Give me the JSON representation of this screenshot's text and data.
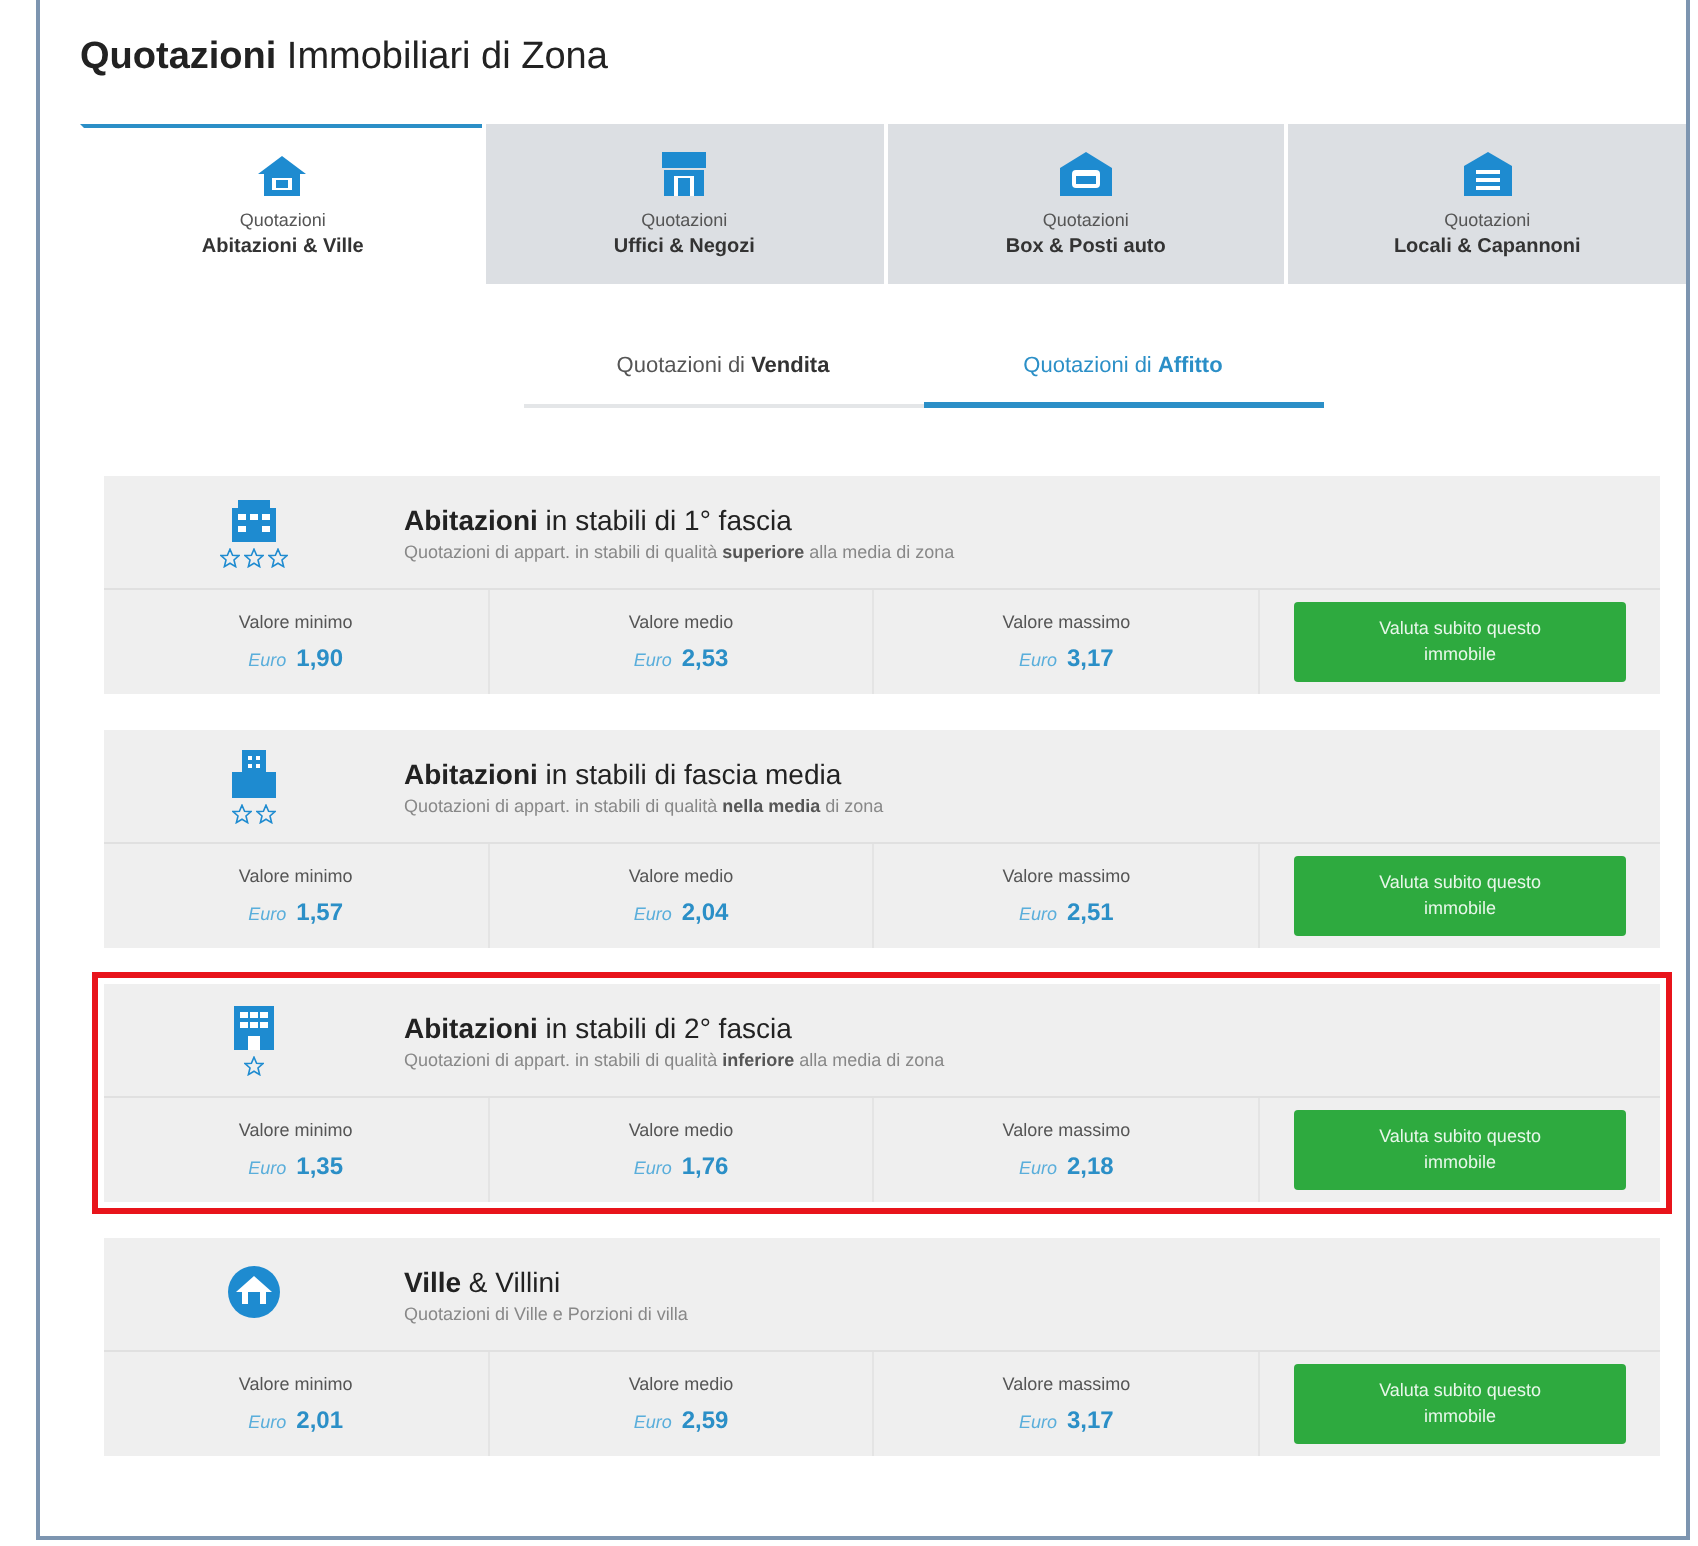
{
  "title": {
    "bold": "Quotazioni",
    "rest": "Immobiliari di Zona"
  },
  "tabs": [
    {
      "label_top": "Quotazioni",
      "label": "Abitazioni & Ville",
      "selected": true
    },
    {
      "label_top": "Quotazioni",
      "label": "Uffici & Negozi",
      "selected": false
    },
    {
      "label_top": "Quotazioni",
      "label": "Box & Posti auto",
      "selected": false
    },
    {
      "label_top": "Quotazioni",
      "label": "Locali & Capannoni",
      "selected": false
    }
  ],
  "subtabs": [
    {
      "label": "Quotazioni di **Vendita**",
      "selected": false
    },
    {
      "label": "Quotazioni di **Affitto**",
      "selected": true
    }
  ],
  "cards": [
    {
      "kind": "upper",
      "highlighted": false,
      "title": "**Abitazioni** in stabili di 1° fascia",
      "subtitle": "Quotazioni di appart. in stabili di qualità **superiore** alla media di zona",
      "values": [
        {
          "label": "Valore minimo",
          "currency": "Euro",
          "amount": "1,90"
        },
        {
          "label": "Valore medio",
          "currency": "Euro",
          "amount": "2,53"
        },
        {
          "label": "Valore massimo",
          "currency": "Euro",
          "amount": "3,17"
        }
      ],
      "button": "Valuta subito questo immobile"
    },
    {
      "kind": "middle",
      "highlighted": false,
      "title": "**Abitazioni** in stabili di fascia media",
      "subtitle": "Quotazioni di appart. in stabili di qualità **nella media** di zona",
      "values": [
        {
          "label": "Valore minimo",
          "currency": "Euro",
          "amount": "1,57"
        },
        {
          "label": "Valore medio",
          "currency": "Euro",
          "amount": "2,04"
        },
        {
          "label": "Valore massimo",
          "currency": "Euro",
          "amount": "2,51"
        }
      ],
      "button": "Valuta subito questo immobile"
    },
    {
      "kind": "lower",
      "highlighted": true,
      "title": "**Abitazioni** in stabili di 2° fascia",
      "subtitle": "Quotazioni di appart. in stabili di qualità **inferiore** alla media di zona",
      "values": [
        {
          "label": "Valore minimo",
          "currency": "Euro",
          "amount": "1,35"
        },
        {
          "label": "Valore medio",
          "currency": "Euro",
          "amount": "1,76"
        },
        {
          "label": "Valore massimo",
          "currency": "Euro",
          "amount": "2,18"
        }
      ],
      "button": "Valuta subito questo immobile"
    },
    {
      "kind": "villa",
      "highlighted": false,
      "title": "**Ville** & Villini",
      "subtitle": "Quotazioni di Ville e Porzioni di villa",
      "values": [
        {
          "label": "Valore minimo",
          "currency": "Euro",
          "amount": "2,01"
        },
        {
          "label": "Valore medio",
          "currency": "Euro",
          "amount": "2,59"
        },
        {
          "label": "Valore massimo",
          "currency": "Euro",
          "amount": "3,17"
        }
      ],
      "button": "Valuta subito questo immobile"
    }
  ]
}
